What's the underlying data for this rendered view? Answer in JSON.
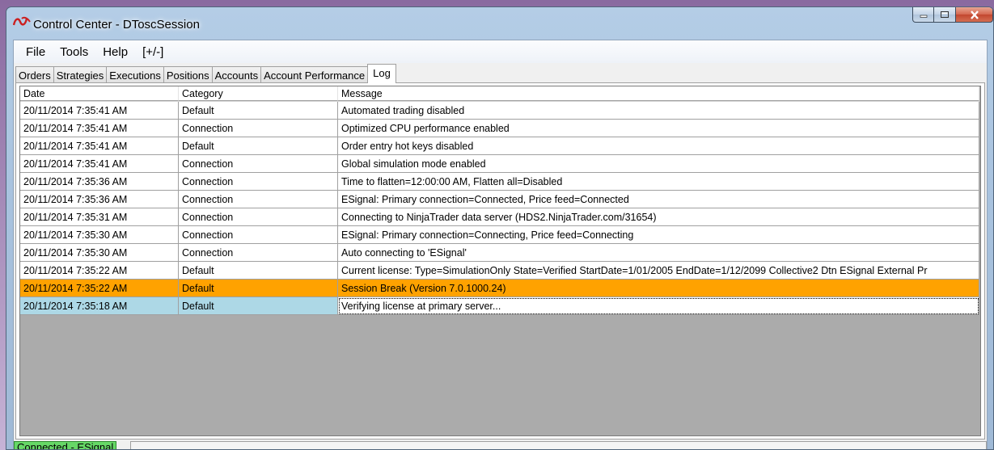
{
  "window": {
    "title": "Control Center - DToscSession"
  },
  "menu": [
    "File",
    "Tools",
    "Help",
    "[+/-]"
  ],
  "tabs": [
    "Orders",
    "Strategies",
    "Executions",
    "Positions",
    "Accounts",
    "Account Performance",
    "Log"
  ],
  "active_tab": "Log",
  "log": {
    "headers": {
      "date": "Date",
      "category": "Category",
      "message": "Message"
    },
    "rows": [
      {
        "date": "20/11/2014 7:35:41 AM",
        "category": "Default",
        "message": "Automated trading disabled",
        "highlight": ""
      },
      {
        "date": "20/11/2014 7:35:41 AM",
        "category": "Connection",
        "message": "Optimized CPU performance enabled",
        "highlight": ""
      },
      {
        "date": "20/11/2014 7:35:41 AM",
        "category": "Default",
        "message": "Order entry hot keys disabled",
        "highlight": ""
      },
      {
        "date": "20/11/2014 7:35:41 AM",
        "category": "Connection",
        "message": "Global simulation mode enabled",
        "highlight": ""
      },
      {
        "date": "20/11/2014 7:35:36 AM",
        "category": "Connection",
        "message": "Time to flatten=12:00:00 AM, Flatten all=Disabled",
        "highlight": ""
      },
      {
        "date": "20/11/2014 7:35:36 AM",
        "category": "Connection",
        "message": "ESignal: Primary connection=Connected, Price feed=Connected",
        "highlight": ""
      },
      {
        "date": "20/11/2014 7:35:31 AM",
        "category": "Connection",
        "message": "Connecting to NinjaTrader data server (HDS2.NinjaTrader.com/31654)",
        "highlight": ""
      },
      {
        "date": "20/11/2014 7:35:30 AM",
        "category": "Connection",
        "message": "ESignal: Primary connection=Connecting, Price feed=Connecting",
        "highlight": ""
      },
      {
        "date": "20/11/2014 7:35:30 AM",
        "category": "Connection",
        "message": "Auto connecting to 'ESignal'",
        "highlight": ""
      },
      {
        "date": "20/11/2014 7:35:22 AM",
        "category": "Default",
        "message": "Current license:  Type=SimulationOnly State=Verified StartDate=1/01/2005 EndDate=1/12/2099 Collective2 Dtn ESignal External Pr",
        "highlight": ""
      },
      {
        "date": "20/11/2014 7:35:22 AM",
        "category": "Default",
        "message": "Session Break (Version 7.0.1000.24)",
        "highlight": "#ffa200"
      },
      {
        "date": "20/11/2014 7:35:18 AM",
        "category": "Default",
        "message": "Verifying license at primary server...",
        "highlight": "#add8e6"
      }
    ]
  },
  "status": {
    "connection": "Connected - ESignal",
    "connection_color": "#66d866"
  }
}
